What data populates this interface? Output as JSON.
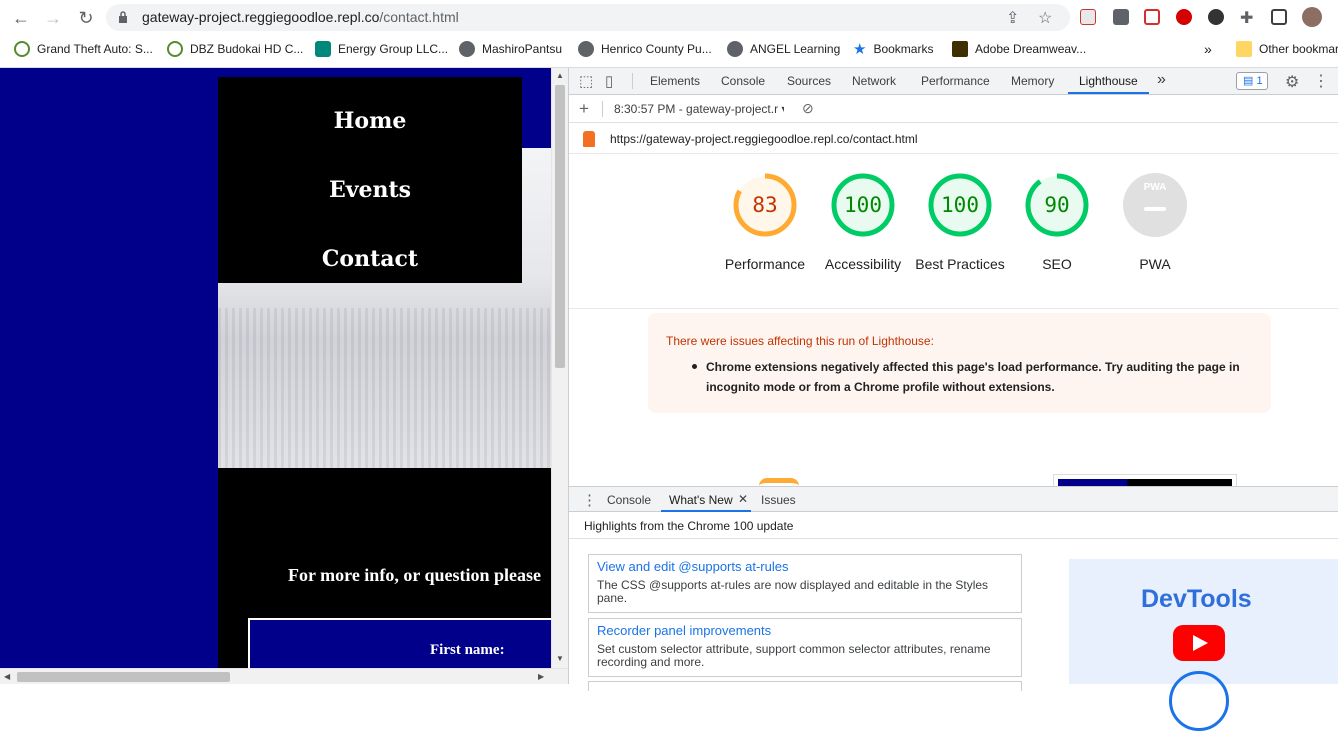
{
  "browser": {
    "url_host": "gateway-project.reggiegoodloe.repl.co",
    "url_path": "/contact.html",
    "bookmarks": [
      {
        "label": "Grand Theft Auto: S...",
        "color": "#2e7d32"
      },
      {
        "label": "DBZ Budokai HD C...",
        "color": "#2e7d32"
      },
      {
        "label": "Energy Group LLC...",
        "color": "#00897b"
      },
      {
        "label": "MashiroPantsu",
        "color": "#5f6368"
      },
      {
        "label": "Henrico County Pu...",
        "color": "#5f6368"
      },
      {
        "label": "ANGEL Learning",
        "color": "#5f6368"
      },
      {
        "label": "Bookmarks",
        "color": "#1a73e8"
      },
      {
        "label": "Adobe Dreamweav...",
        "color": "#5f4b00"
      }
    ],
    "other_bookmarks": "Other bookmarks"
  },
  "page": {
    "nav": [
      "Home",
      "Events",
      "Contact"
    ],
    "info_text": "For more info, or question please",
    "first_name_label": "First name:"
  },
  "devtools": {
    "tabs": [
      "Elements",
      "Console",
      "Sources",
      "Network",
      "Performance",
      "Memory",
      "Lighthouse"
    ],
    "more": "»",
    "issues_count": "1",
    "report_select": "8:30:57 PM - gateway-project.r",
    "lighthouse_url": "https://gateway-project.reggiegoodloe.repl.co/contact.html",
    "scores": [
      {
        "value": "83",
        "label": "Performance",
        "color": "#fa3",
        "text_color": "#c33300",
        "fraction": 0.83
      },
      {
        "value": "100",
        "label": "Accessibility",
        "color": "#0c6",
        "text_color": "#008800",
        "fraction": 1.0
      },
      {
        "value": "100",
        "label": "Best Practices",
        "color": "#0c6",
        "text_color": "#008800",
        "fraction": 1.0
      },
      {
        "value": "90",
        "label": "SEO",
        "color": "#0c6",
        "text_color": "#008800",
        "fraction": 0.9
      }
    ],
    "pwa_label": "PWA",
    "pwa_badge": "PWA",
    "warning_title": "There were issues affecting this run of Lighthouse:",
    "warning_item": "Chrome extensions negatively affected this page's load performance. Try auditing the page in incognito mode or from a Chrome profile without extensions.",
    "drawer_tabs": [
      "Console",
      "What's New",
      "Issues"
    ],
    "whats_new_heading": "Highlights from the Chrome 100 update",
    "news": [
      {
        "title": "View and edit @supports at-rules",
        "desc": "The CSS @supports at-rules are now displayed and editable in the Styles pane."
      },
      {
        "title": "Recorder panel improvements",
        "desc": "Set custom selector attribute, support common selector attributes, rename recording and more."
      }
    ],
    "promo_title": "DevTools"
  }
}
